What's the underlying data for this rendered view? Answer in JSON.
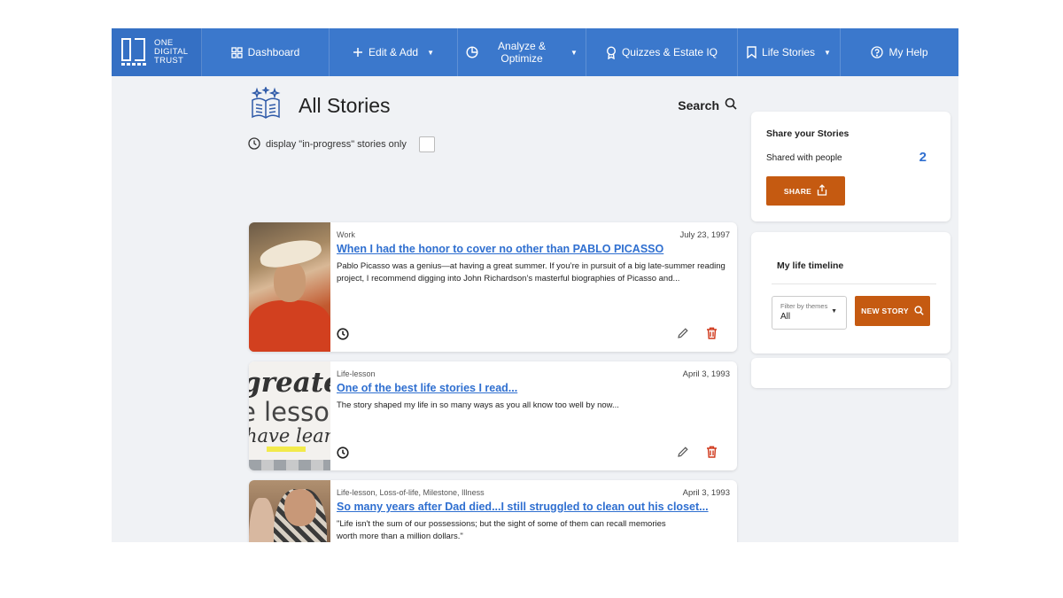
{
  "brand": {
    "line1": "ONE",
    "line2": "DIGITAL",
    "line3": "TRUST"
  },
  "nav": {
    "dashboard": "Dashboard",
    "edit_add": "Edit & Add",
    "analyze_line1": "Analyze &",
    "analyze_line2": "Optimize",
    "quizzes": "Quizzes & Estate IQ",
    "life_stories": "Life Stories",
    "help": "My Help"
  },
  "page": {
    "title": "All Stories",
    "search_label": "Search",
    "filter_label": "display \"in-progress\" stories only",
    "filter_checked": false
  },
  "stories": [
    {
      "tags": "Work",
      "date": "July 23, 1997",
      "title": "When I had the honor to cover no other than PABLO PICASSO",
      "excerpt": "Pablo Picasso was a genius—at having a great summer. If you’re in pursuit of a big late-summer reading project, I recommend digging into John Richardson’s masterful biographies of Picasso and..."
    },
    {
      "tags": "Life-lesson",
      "date": "April 3, 1993",
      "title": "One of the best life stories I read...",
      "excerpt": "The story shaped my life in so many ways as you all know too well by now...",
      "thumb_text": [
        "greates",
        "e lesso",
        "have learn"
      ]
    },
    {
      "tags": "Life-lesson, Loss-of-life, Milestone, Illness",
      "date": "April 3, 1993",
      "title": "So many years after Dad died...I still struggled to clean out his closet...",
      "excerpt": "\"Life isn't the sum of our possessions; but the sight of some of them can recall memories worth more than a million dollars.\""
    }
  ],
  "share_panel": {
    "heading": "Share your Stories",
    "shared_label": "Shared with people",
    "shared_count": "2",
    "share_button": "SHARE"
  },
  "timeline_panel": {
    "heading": "My life timeline",
    "filter_label": "Filter by themes",
    "filter_value": "All",
    "new_story_button": "NEW STORY"
  },
  "colors": {
    "nav": "#3b78cc",
    "accent": "#c55a11",
    "link": "#2f6fd0",
    "delete": "#d0391c"
  }
}
